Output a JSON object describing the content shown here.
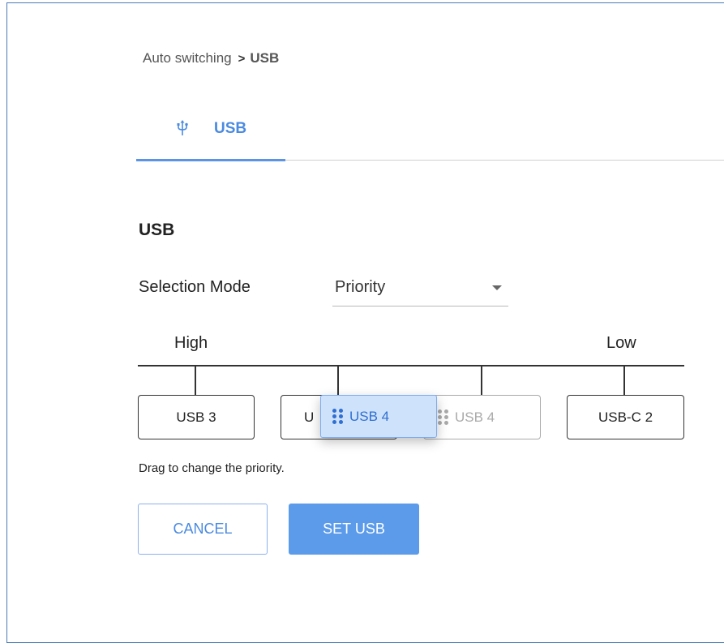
{
  "breadcrumb": {
    "parent": "Auto switching",
    "separator": ">",
    "current": "USB"
  },
  "tabs": [
    {
      "label": "USB",
      "icon": "usb-icon",
      "active": true
    }
  ],
  "section": {
    "title": "USB"
  },
  "selection_mode": {
    "label": "Selection Mode",
    "value": "Priority"
  },
  "priority": {
    "high_label": "High",
    "low_label": "Low",
    "slots": [
      {
        "label": "USB 3",
        "state": "normal"
      },
      {
        "label": "U",
        "state": "partially-covered"
      },
      {
        "label": "USB 4",
        "state": "ghost"
      },
      {
        "label": "USB-C 2",
        "state": "normal"
      }
    ],
    "dragging_item": {
      "label": "USB 4"
    }
  },
  "hint": "Drag to change the priority.",
  "buttons": {
    "cancel": "CANCEL",
    "submit": "SET USB"
  },
  "colors": {
    "accent": "#5b9bea",
    "tab_text": "#4a8ae0",
    "drag_bg": "#cfe2fb",
    "frame_border": "#4a7ab8"
  }
}
